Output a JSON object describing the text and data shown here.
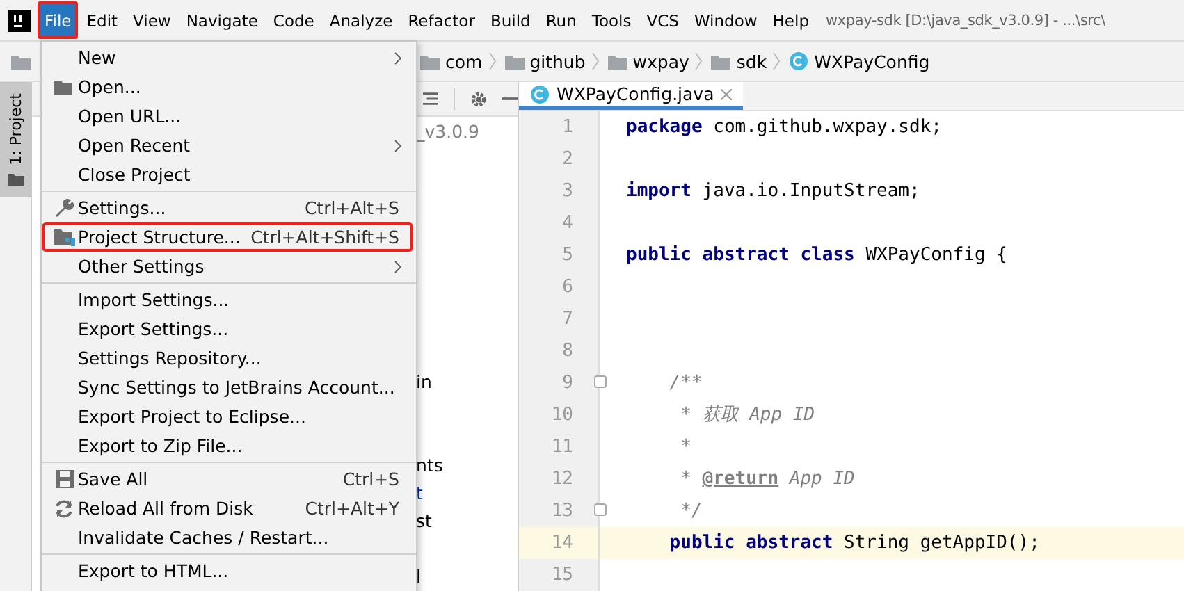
{
  "menubar": {
    "items": [
      {
        "label": "File",
        "selected": true,
        "highlighted": true
      },
      {
        "label": "Edit",
        "selected": false,
        "highlighted": false
      },
      {
        "label": "View",
        "selected": false,
        "highlighted": false
      },
      {
        "label": "Navigate",
        "selected": false,
        "highlighted": false
      },
      {
        "label": "Code",
        "selected": false,
        "highlighted": false
      },
      {
        "label": "Analyze",
        "selected": false,
        "highlighted": false
      },
      {
        "label": "Refactor",
        "selected": false,
        "highlighted": false
      },
      {
        "label": "Build",
        "selected": false,
        "highlighted": false
      },
      {
        "label": "Run",
        "selected": false,
        "highlighted": false
      },
      {
        "label": "Tools",
        "selected": false,
        "highlighted": false
      },
      {
        "label": "VCS",
        "selected": false,
        "highlighted": false
      },
      {
        "label": "Window",
        "selected": false,
        "highlighted": false
      },
      {
        "label": "Help",
        "selected": false,
        "highlighted": false
      }
    ],
    "title": "wxpay-sdk [D:\\java_sdk_v3.0.9] - ...\\src\\"
  },
  "breadcrumbs": [
    {
      "label": "com",
      "kind": "folder"
    },
    {
      "label": "github",
      "kind": "folder"
    },
    {
      "label": "wxpay",
      "kind": "folder"
    },
    {
      "label": "sdk",
      "kind": "folder"
    },
    {
      "label": "WXPayConfig",
      "kind": "class"
    }
  ],
  "tool_stripe": {
    "tab": "1: Project",
    "selected": true
  },
  "project_tree": [
    {
      "text": "_v3.0.9",
      "color": "#808080"
    },
    {
      "text": "in",
      "color": "#000000"
    },
    {
      "text": "nts",
      "color": "#000000"
    },
    {
      "text": "t",
      "color": "#0033b3"
    },
    {
      "text": "st",
      "color": "#000000"
    },
    {
      "text": "l",
      "color": "#000000"
    }
  ],
  "file_menu": {
    "sections": [
      [
        {
          "label": "New",
          "submenu": true,
          "highlighted": false
        },
        {
          "label": "Open...",
          "kind": "open",
          "submenu": false,
          "highlighted": false
        },
        {
          "label": "Open URL...",
          "submenu": false,
          "highlighted": false
        },
        {
          "label": "Open Recent",
          "submenu": true,
          "highlighted": false
        },
        {
          "label": "Close Project",
          "submenu": false,
          "highlighted": false
        }
      ],
      [
        {
          "label": "Settings...",
          "kind": "settings",
          "shortcut": "Ctrl+Alt+S",
          "submenu": false,
          "highlighted": false
        },
        {
          "label": "Project Structure...",
          "kind": "structure",
          "shortcut": "Ctrl+Alt+Shift+S",
          "submenu": false,
          "highlighted": true
        },
        {
          "label": "Other Settings",
          "submenu": true,
          "highlighted": false
        }
      ],
      [
        {
          "label": "Import Settings...",
          "submenu": false,
          "highlighted": false
        },
        {
          "label": "Export Settings...",
          "submenu": false,
          "highlighted": false
        },
        {
          "label": "Settings Repository...",
          "submenu": false,
          "highlighted": false
        },
        {
          "label": "Sync Settings to JetBrains Account...",
          "submenu": false,
          "highlighted": false
        },
        {
          "label": "Export Project to Eclipse...",
          "submenu": false,
          "highlighted": false
        },
        {
          "label": "Export to Zip File...",
          "submenu": false,
          "highlighted": false
        }
      ],
      [
        {
          "label": "Save All",
          "kind": "save",
          "shortcut": "Ctrl+S",
          "submenu": false,
          "highlighted": false
        },
        {
          "label": "Reload All from Disk",
          "kind": "reload",
          "shortcut": "Ctrl+Alt+Y",
          "submenu": false,
          "highlighted": false
        },
        {
          "label": "Invalidate Caches / Restart...",
          "submenu": false,
          "highlighted": false
        }
      ],
      [
        {
          "label": "Export to HTML...",
          "submenu": false,
          "highlighted": false
        }
      ]
    ]
  },
  "editor": {
    "tab": {
      "label": "WXPayConfig.java",
      "selected": true
    },
    "lines": [
      {
        "number": "1",
        "current": false,
        "fold": false,
        "tokens": [
          {
            "kind": "keyword",
            "text": "package"
          },
          {
            "kind": "plain",
            "text": " com.github.wxpay.sdk;"
          }
        ]
      },
      {
        "number": "2",
        "current": false,
        "fold": false
      },
      {
        "number": "3",
        "current": false,
        "fold": false,
        "tokens": [
          {
            "kind": "keyword",
            "text": "import"
          },
          {
            "kind": "plain",
            "text": " java.io.InputStream;"
          }
        ]
      },
      {
        "number": "4",
        "current": false,
        "fold": false
      },
      {
        "number": "5",
        "current": false,
        "fold": false,
        "tokens": [
          {
            "kind": "keyword",
            "text": "public abstract class"
          },
          {
            "kind": "plain",
            "text": " WXPayConfig {"
          }
        ]
      },
      {
        "number": "6",
        "current": false,
        "fold": false
      },
      {
        "number": "7",
        "current": false,
        "fold": false
      },
      {
        "number": "8",
        "current": false,
        "fold": false
      },
      {
        "number": "9",
        "current": false,
        "fold": true,
        "nested": true,
        "tokens": [
          {
            "kind": "comment",
            "text": "/**"
          }
        ]
      },
      {
        "number": "10",
        "current": false,
        "fold": false,
        "nested": true,
        "tokens": [
          {
            "kind": "comment",
            "text": " * 获取 App ID"
          }
        ]
      },
      {
        "number": "11",
        "current": false,
        "fold": false,
        "nested": true,
        "tokens": [
          {
            "kind": "comment",
            "text": " *"
          }
        ]
      },
      {
        "number": "12",
        "current": false,
        "fold": false,
        "nested": true,
        "tokens": [
          {
            "kind": "comment",
            "text": " * "
          },
          {
            "kind": "tag",
            "text": "@return"
          },
          {
            "kind": "comment",
            "text": " App ID"
          }
        ]
      },
      {
        "number": "13",
        "current": false,
        "fold": true,
        "nested": true,
        "tokens": [
          {
            "kind": "comment",
            "text": " */"
          }
        ]
      },
      {
        "number": "14",
        "current": true,
        "fold": false,
        "nested": true,
        "tokens": [
          {
            "kind": "keyword",
            "text": "public abstract"
          },
          {
            "kind": "plain",
            "text": " String getAppID();"
          }
        ]
      },
      {
        "number": "15",
        "current": false,
        "fold": false
      }
    ]
  }
}
